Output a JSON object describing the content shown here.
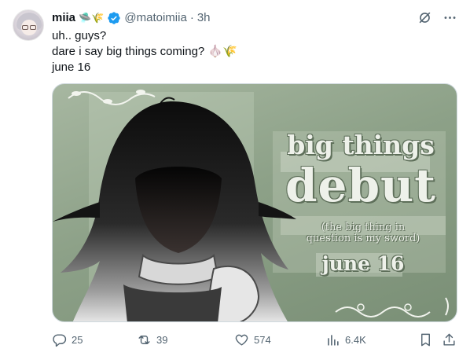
{
  "author": {
    "name": "miia",
    "handle": "@matoimiia",
    "separator": "·",
    "time": "3h",
    "name_emojis": "🛸🌾"
  },
  "tweet": {
    "lines": [
      "uh.. guys?",
      "dare i say big things coming? 🧄🌾",
      "june 16"
    ]
  },
  "media": {
    "headline_top": "big things",
    "headline_main": "debut",
    "subtitle_line1": "(the big thing in",
    "subtitle_line2": "question is my sword)",
    "date": "june 16"
  },
  "actions": {
    "replies": "25",
    "reposts": "39",
    "likes": "574",
    "views": "6.4K"
  },
  "colors": {
    "verified": "#1d9bf0",
    "secondary_text": "#536471",
    "border": "#cfd9de"
  },
  "icons": [
    "grok-icon",
    "more-icon",
    "reply-icon",
    "repost-icon",
    "like-icon",
    "views-icon",
    "bookmark-icon",
    "share-icon",
    "verified-badge-icon"
  ]
}
